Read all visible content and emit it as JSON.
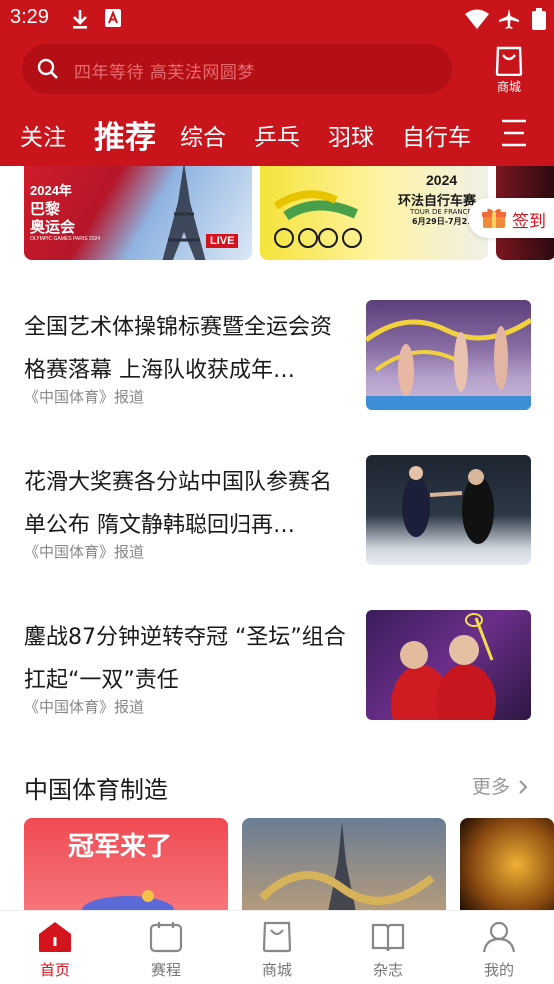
{
  "status": {
    "time": "3:29"
  },
  "search": {
    "placeholder": "四年等待 高芙法网圆梦"
  },
  "shop": {
    "label": "商城"
  },
  "tabs": [
    {
      "label": "关注"
    },
    {
      "label": "推荐"
    },
    {
      "label": "综合"
    },
    {
      "label": "乒乓"
    },
    {
      "label": "羽球"
    },
    {
      "label": "自行车"
    }
  ],
  "banners": {
    "b1_year": "2024年",
    "b1_line1": "巴黎",
    "b1_line2": "奥运会",
    "b1_small": "OLYMPIC GAMES PARIS 2024",
    "b1_live": "LIVE",
    "b2_year": "2024",
    "b2_title": "环法自行车赛",
    "b2_sub": "TOUR DE FRANCE",
    "b2_date": "6月29日-7月21"
  },
  "signin": {
    "label": "签到"
  },
  "articles": [
    {
      "title": "全国艺术体操锦标赛暨全运会资格赛落幕 上海队收获成年…",
      "source": "《中国体育》报道"
    },
    {
      "title": "花滑大奖赛各分站中国队参赛名单公布 隋文静韩聪回归再…",
      "source": "《中国体育》报道"
    },
    {
      "title": "鏖战87分钟逆转夺冠 “圣坛”组合扛起“一双”责任",
      "source": "《中国体育》报道"
    }
  ],
  "section": {
    "title": "中国体育制造",
    "more": "更多"
  },
  "cards": {
    "c1_text": "冠军来了"
  },
  "bottom_nav": [
    {
      "label": "首页",
      "icon": "home-icon",
      "active": true
    },
    {
      "label": "赛程",
      "icon": "calendar-icon",
      "active": false
    },
    {
      "label": "商城",
      "icon": "shopping-bag-icon",
      "active": false
    },
    {
      "label": "杂志",
      "icon": "book-icon",
      "active": false
    },
    {
      "label": "我的",
      "icon": "user-icon",
      "active": false
    }
  ],
  "colors": {
    "brand_red": "#c9141b",
    "active_red": "#d4141c",
    "text": "#1a1a1a",
    "muted": "#888888"
  }
}
